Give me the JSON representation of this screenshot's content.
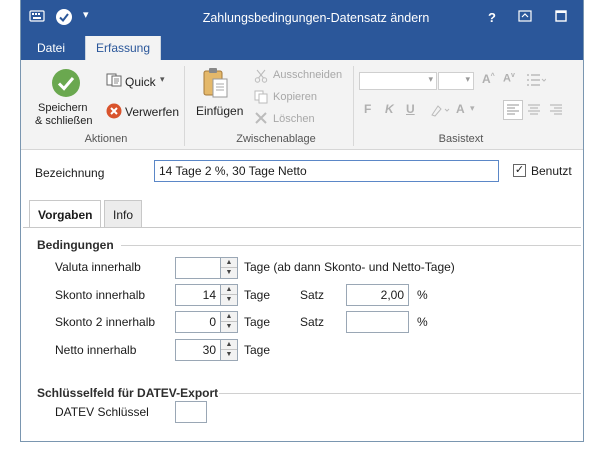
{
  "window": {
    "title": "Zahlungsbedingungen-Datensatz ändern",
    "help_label": "?",
    "titlebar_colors": {
      "accent": "#2b579a"
    }
  },
  "ribbon_tabs": [
    {
      "label": "Datei"
    },
    {
      "label": "Erfassung"
    }
  ],
  "ribbon": {
    "aktionen": {
      "save_label_line1": "Speichern",
      "save_label_line2": "& schließen",
      "quick_label": "Quick",
      "discard_label": "Verwerfen",
      "group_label": "Aktionen"
    },
    "zwischenablage": {
      "paste_label": "Einfügen",
      "cut_label": "Ausschneiden",
      "copy_label": "Kopieren",
      "delete_label": "Löschen",
      "group_label": "Zwischenablage"
    },
    "basistext": {
      "bold": "F",
      "italic": "K",
      "underline": "U",
      "group_label": "Basistext"
    }
  },
  "form": {
    "bezeichnung_label": "Bezeichnung",
    "bezeichnung_value": "14 Tage 2 %, 30 Tage Netto",
    "benutzt_label": "Benutzt",
    "benutzt_checked": true
  },
  "page_tabs": [
    {
      "label": "Vorgaben"
    },
    {
      "label": "Info"
    }
  ],
  "bedingungen": {
    "heading": "Bedingungen",
    "valuta_label": "Valuta innerhalb",
    "valuta_value": "",
    "valuta_suffix": "Tage (ab dann Skonto- und Netto-Tage)",
    "skonto_label": "Skonto innerhalb",
    "skonto_value": "14",
    "skonto_suffix": "Tage",
    "skonto_satz_label": "Satz",
    "skonto_satz_value": "2,00",
    "skonto_satz_unit": "%",
    "skonto2_label": "Skonto 2 innerhalb",
    "skonto2_value": "0",
    "skonto2_suffix": "Tage",
    "skonto2_satz_label": "Satz",
    "skonto2_satz_value": "",
    "skonto2_satz_unit": "%",
    "netto_label": "Netto innerhalb",
    "netto_value": "30",
    "netto_suffix": "Tage"
  },
  "datev": {
    "heading": "Schlüsselfeld für DATEV-Export",
    "key_label": "DATEV Schlüssel",
    "key_value": ""
  }
}
